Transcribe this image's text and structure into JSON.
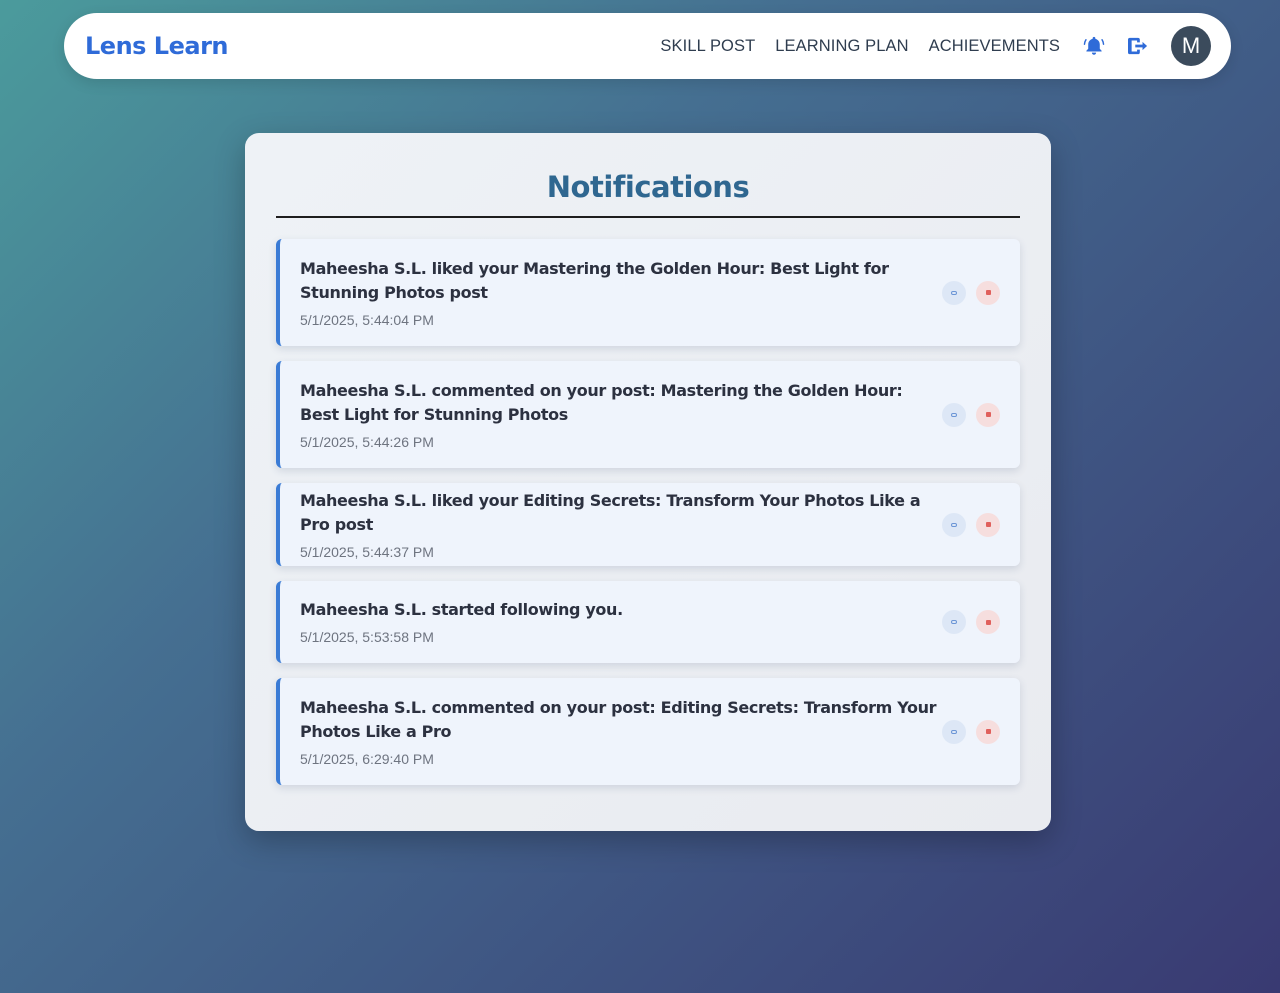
{
  "brand": "Lens Learn",
  "nav": {
    "links": [
      "SKILL POST",
      "LEARNING PLAN",
      "ACHIEVEMENTS"
    ],
    "notification_icon": "bell-icon",
    "logout_icon": "logout-icon",
    "avatar_initial": "M"
  },
  "panel": {
    "title": "Notifications",
    "items": [
      {
        "message": "Maheesha S.L. liked your Mastering the Golden Hour: Best Light for Stunning Photos post",
        "time": "5/1/2025, 5:44:04 PM"
      },
      {
        "message": "Maheesha S.L. commented on your post: Mastering the Golden Hour: Best Light for Stunning Photos",
        "time": "5/1/2025, 5:44:26 PM"
      },
      {
        "message": "Maheesha S.L. liked your Editing Secrets: Transform Your Photos Like a Pro post",
        "time": "5/1/2025, 5:44:37 PM"
      },
      {
        "message": "Maheesha S.L. started following you.",
        "time": "5/1/2025, 5:53:58 PM"
      },
      {
        "message": "Maheesha S.L. commented on your post: Editing Secrets: Transform Your Photos Like a Pro",
        "time": "5/1/2025, 6:29:40 PM"
      }
    ]
  },
  "colors": {
    "accent": "#2f6bd8",
    "title": "#2f6790",
    "card_border": "#3a7bd5"
  }
}
